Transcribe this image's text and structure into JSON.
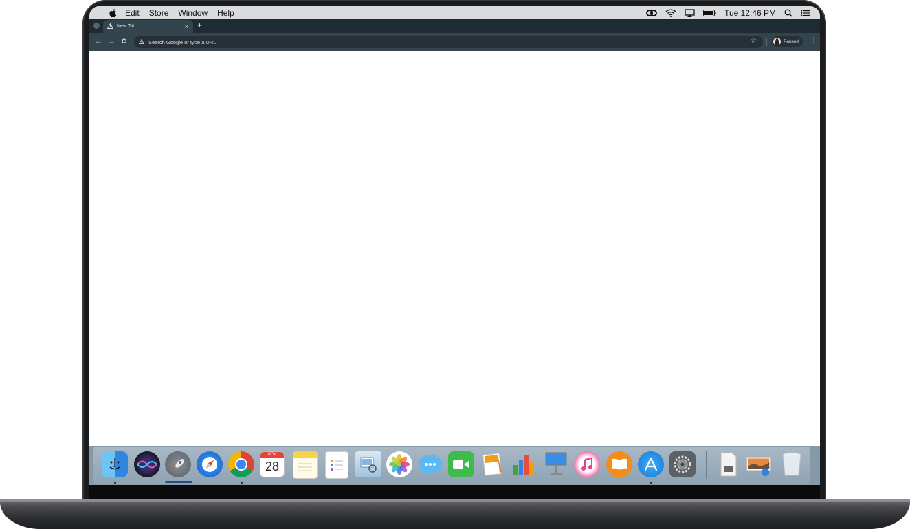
{
  "menubar": {
    "items": [
      "Edit",
      "Store",
      "Window",
      "Help"
    ],
    "clock": "Tue 12:46 PM"
  },
  "tab": {
    "title": "New Tab",
    "close": "×",
    "new_tab": "+"
  },
  "toolbar": {
    "back": "←",
    "forward": "→",
    "reload": "C",
    "omnibox_placeholder": "Search Google or type a URL",
    "bookmark": "☆",
    "profile_status": "Paused",
    "menu": "⋮"
  },
  "dock": {
    "calendar_month": "NOV",
    "calendar_day": "28",
    "apps": [
      "finder",
      "siri",
      "launchpad",
      "safari",
      "chrome",
      "calendar",
      "notes",
      "reminders",
      "preview",
      "photos",
      "messages",
      "facetime",
      "pages",
      "numbers",
      "keynote",
      "itunes",
      "ibooks",
      "app-store",
      "system-preferences",
      "installer",
      "screenshot",
      "trash"
    ]
  }
}
